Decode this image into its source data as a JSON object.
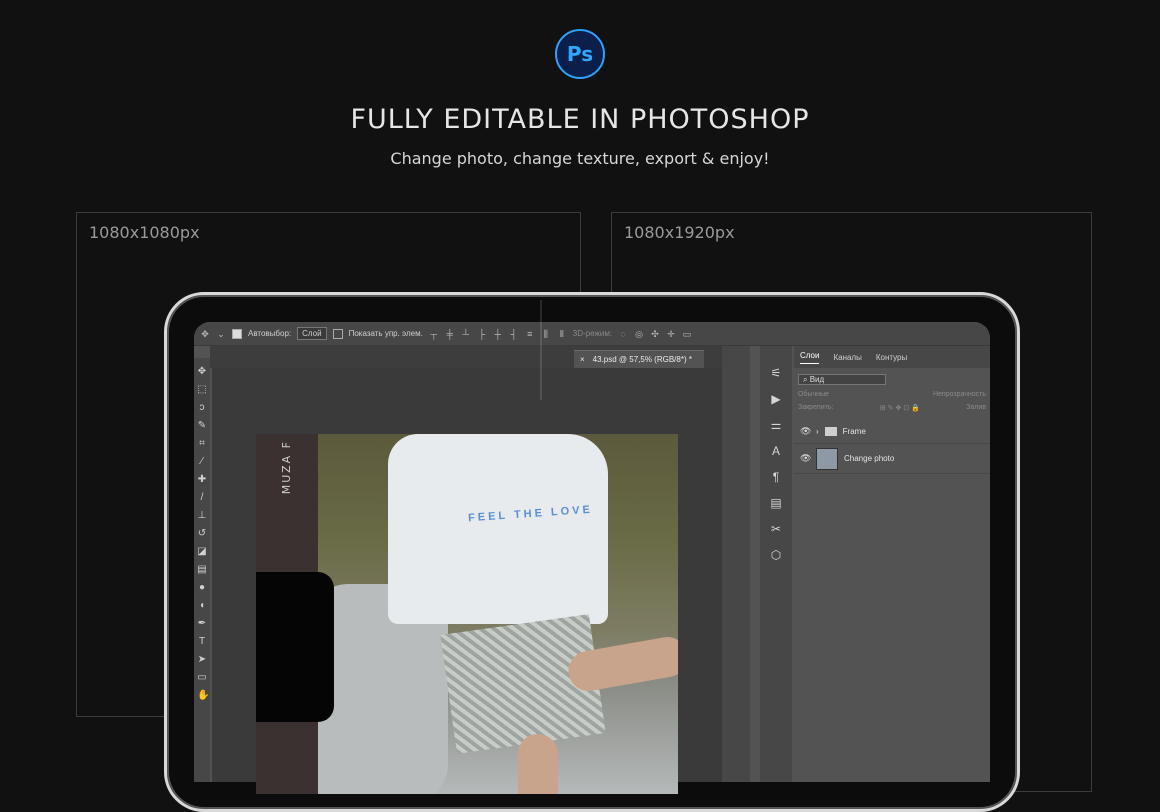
{
  "badge": {
    "text": "Ps"
  },
  "headline": "FULLY EDITABLE IN PHOTOSHOP",
  "subline": "Change photo, change texture, export & enjoy!",
  "frames": [
    {
      "label": "1080x1080px"
    },
    {
      "label": "1080x1920px"
    }
  ],
  "photoshop": {
    "options_bar": {
      "autoselect_label": "Автовыбор:",
      "autoselect_value": "Слой",
      "show_controls_label": "Показать упр. элем.",
      "mode_3d_label": "3D-режим:"
    },
    "doc_tab": {
      "title": "43.psd @ 57,5% (RGB/8*) *"
    },
    "poster_vertical_text": "MUZA F",
    "shirt_text": "FEEL THE LOVE",
    "layers_panel": {
      "tabs": [
        "Слои",
        "Каналы",
        "Контуры"
      ],
      "active_tab": "Слои",
      "search_placeholder": "Вид",
      "blend_mode": "Обычные",
      "opacity_label": "Непрозрачность",
      "lock_label": "Закрепить:",
      "fill_label": "Залив",
      "layers": [
        {
          "name": "Frame",
          "type": "folder"
        },
        {
          "name": "Change photo",
          "type": "smart-object"
        }
      ]
    }
  }
}
